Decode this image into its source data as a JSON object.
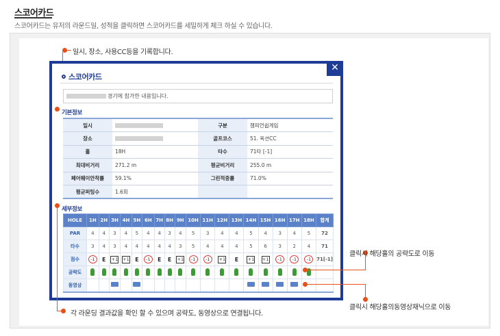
{
  "header": {
    "title": "스코어카드",
    "description": "스코어카드는 유저의 라운드일, 성적을 클릭하면 스코어카드를 세밀하게 체크 하실 수 있습니다."
  },
  "callouts": {
    "top": "일시, 장소, 사용CC등을 기록합니다.",
    "bottom": "각 라운딩 결과값을 확인 할 수 있으며 공략도, 동영상으로 연결됩니다.",
    "right_strategy": "클릭시 해당홀의 공략도로 이동",
    "right_video": "클릭시 해당홀의동영상재닉으로 이동"
  },
  "popup": {
    "title": "스코어카드",
    "close_label": "✕",
    "intro_text": "경기에 참가한 내용입니다.",
    "basic_section": "기본정보",
    "detail_section": "세부정보",
    "basic_rows": [
      {
        "k1": "일시",
        "v1": "",
        "k2": "구분",
        "v2": "챔피언쉽게임"
      },
      {
        "k1": "장소",
        "v1": "",
        "k2": "골프코스",
        "v2": "51. 옥션CC"
      },
      {
        "k1": "홀",
        "v1": "18H",
        "k2": "타수",
        "v2": "71타 [-1]"
      },
      {
        "k1": "최대비거리",
        "v1": "271.2 m",
        "k2": "평균비거리",
        "v2": "255.0 m"
      },
      {
        "k1": "페어웨이안착률",
        "v1": "59.1%",
        "k2": "그린적중률",
        "v2": "71.0%"
      },
      {
        "k1": "평균퍼팅수",
        "v1": "1.6회",
        "k2": "",
        "v2": ""
      }
    ],
    "holes": [
      "HOLE",
      "1H",
      "2H",
      "3H",
      "4H",
      "5H",
      "6H",
      "7H",
      "8H",
      "9H",
      "10H",
      "11H",
      "12H",
      "13H",
      "14H",
      "15H",
      "16H",
      "17H",
      "18H",
      "합계"
    ],
    "par": [
      "PAR",
      "4",
      "4",
      "3",
      "4",
      "5",
      "4",
      "4",
      "3",
      "4",
      "5",
      "3",
      "4",
      "4",
      "5",
      "4",
      "3",
      "4",
      "5",
      "72"
    ],
    "strokes": [
      "타수",
      "3",
      "4",
      "3",
      "4",
      "4",
      "4",
      "4",
      "4",
      "3",
      "5",
      "4",
      "4",
      "4",
      "5",
      "6",
      "3",
      "2",
      "4",
      "71"
    ],
    "score_label": "점수",
    "score_total": "71[-1]",
    "scores": [
      {
        "t": "-1",
        "s": "circ"
      },
      {
        "t": "E",
        "s": "plain"
      },
      {
        "t": "+1",
        "s": "sq"
      },
      {
        "t": "+1",
        "s": "sq"
      },
      {
        "t": "E",
        "s": "plain"
      },
      {
        "t": "-1",
        "s": "circ"
      },
      {
        "t": "E",
        "s": "plain"
      },
      {
        "t": "E",
        "s": "plain"
      },
      {
        "t": "+1",
        "s": "sq"
      },
      {
        "t": "-1",
        "s": "circ"
      },
      {
        "t": "-1",
        "s": "circ"
      },
      {
        "t": "+1",
        "s": "sq"
      },
      {
        "t": "E",
        "s": "plain"
      },
      {
        "t": "+1",
        "s": "sq"
      },
      {
        "t": "+1",
        "s": "sq"
      },
      {
        "t": "-1",
        "s": "circ"
      },
      {
        "t": "-1",
        "s": "circ"
      },
      {
        "t": "-1",
        "s": "circ"
      }
    ],
    "strategy_label": "공략도",
    "video_label": "동영상",
    "video_holes": [
      3,
      5,
      14,
      15,
      16,
      17
    ]
  }
}
